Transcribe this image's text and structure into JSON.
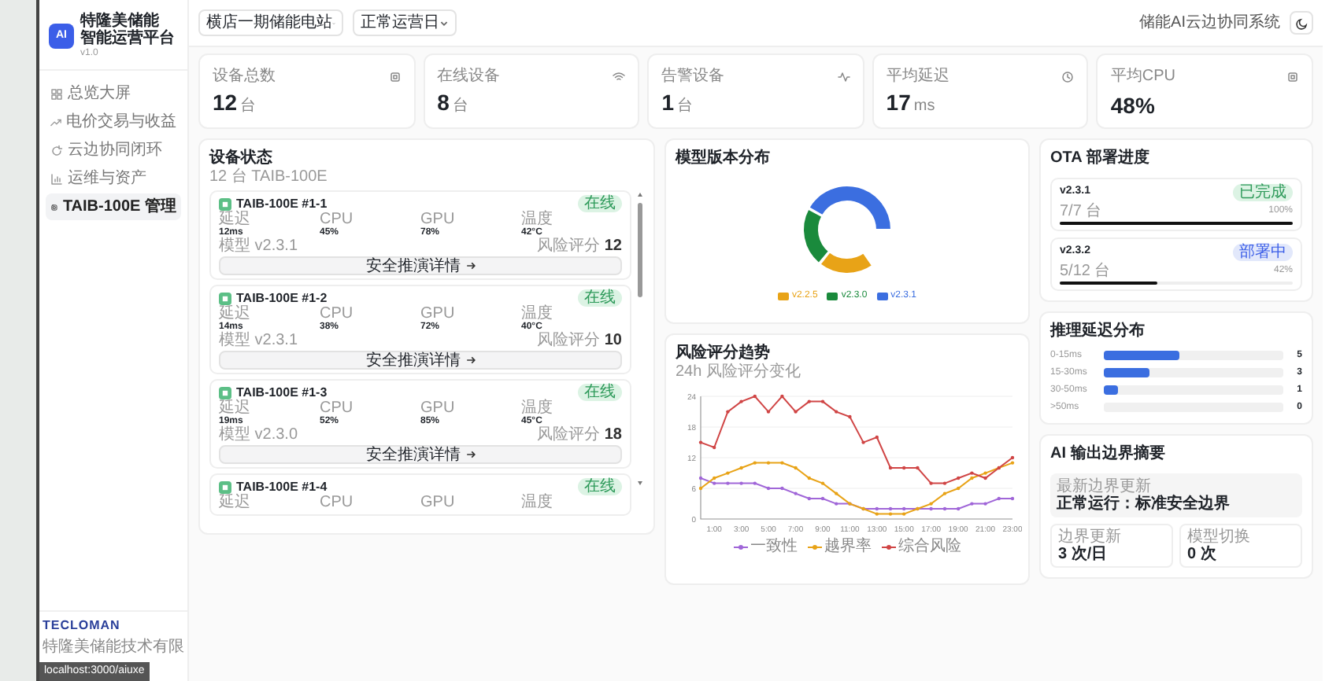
{
  "sidebar": {
    "logo": "AI",
    "title_line_1": "特隆美储能",
    "title_line_2": "智能运营平台",
    "version": "v1.0",
    "items": [
      {
        "label": "总览大屏",
        "selected": false
      },
      {
        "label": "电价交易与收益",
        "selected": false
      },
      {
        "label": "云边协同闭环",
        "selected": false
      },
      {
        "label": "运维与资产",
        "selected": false
      },
      {
        "label": "TAIB-100E 管理",
        "selected": true
      }
    ],
    "footer_logo": "TECLOMAN",
    "footer_text": "特隆美储能技术有限"
  },
  "topbar": {
    "site": "横店一期储能电站",
    "mode": "正常运营日",
    "system": "储能AI云边协同系统"
  },
  "stats": [
    {
      "label": "设备总数",
      "value": "12",
      "unit": "台"
    },
    {
      "label": "在线设备",
      "value": "8",
      "unit": "台"
    },
    {
      "label": "告警设备",
      "value": "1",
      "unit": "台"
    },
    {
      "label": "平均延迟",
      "value": "17",
      "unit": "ms"
    },
    {
      "label": "平均CPU",
      "value": "48%"
    }
  ],
  "devices": {
    "title": "设备状态",
    "subtitle": "12 台 TAIB-100E",
    "items": [
      {
        "name": "TAIB-100E #1-1",
        "status": "在线",
        "metrics": [
          {
            "label": "延迟",
            "value": "12ms"
          },
          {
            "label": "CPU",
            "value": "45%"
          },
          {
            "label": "GPU",
            "value": "78%"
          },
          {
            "label": "温度",
            "value": "42°C"
          }
        ],
        "model": "模型 v2.3.1",
        "risk_label": "风险评分",
        "risk": "12",
        "action": "安全推演详情"
      },
      {
        "name": "TAIB-100E #1-2",
        "status": "在线",
        "metrics": [
          {
            "label": "延迟",
            "value": "14ms"
          },
          {
            "label": "CPU",
            "value": "38%"
          },
          {
            "label": "GPU",
            "value": "72%"
          },
          {
            "label": "温度",
            "value": "40°C"
          }
        ],
        "model": "模型 v2.3.1",
        "risk_label": "风险评分",
        "risk": "10",
        "action": "安全推演详情"
      },
      {
        "name": "TAIB-100E #1-3",
        "status": "在线",
        "metrics": [
          {
            "label": "延迟",
            "value": "19ms"
          },
          {
            "label": "CPU",
            "value": "52%"
          },
          {
            "label": "GPU",
            "value": "85%"
          },
          {
            "label": "温度",
            "value": "45°C"
          }
        ],
        "model": "模型 v2.3.0",
        "risk_label": "风险评分",
        "risk": "18",
        "action": "安全推演详情"
      },
      {
        "name": "TAIB-100E #1-4",
        "status": "在线",
        "metrics": [
          {
            "label": "延迟"
          },
          {
            "label": "CPU"
          },
          {
            "label": "GPU"
          },
          {
            "label": "温度"
          }
        ]
      }
    ]
  },
  "model_versions": {
    "title": "模型版本分布",
    "legend": [
      {
        "label": "v2.2.5",
        "color": "#e8a317"
      },
      {
        "label": "v2.3.0",
        "color": "#1a8a3c"
      },
      {
        "label": "v2.3.1",
        "color": "#3b6ee0"
      }
    ]
  },
  "risk_trend": {
    "title": "风险评分趋势",
    "subtitle": "24h 风险评分变化",
    "chart_data": {
      "type": "line",
      "x": [
        0,
        1,
        2,
        3,
        4,
        5,
        6,
        7,
        8,
        9,
        10,
        11,
        12,
        13,
        14,
        15,
        16,
        17,
        18,
        19,
        20,
        21,
        22,
        23
      ],
      "xlim": [
        0,
        23
      ],
      "ylim": [
        0,
        24
      ],
      "grid": true,
      "legend": true,
      "yticks": [
        0,
        6,
        12,
        18,
        24
      ],
      "xticks": [
        {
          "value": 1,
          "label": "1:00"
        },
        {
          "value": 3,
          "label": "3:00"
        },
        {
          "value": 5,
          "label": "5:00"
        },
        {
          "value": 7,
          "label": "7:00"
        },
        {
          "value": 9,
          "label": "9:00"
        },
        {
          "value": 11,
          "label": "11:00"
        },
        {
          "value": 13,
          "label": "13:00"
        },
        {
          "value": 15,
          "label": "15:00"
        },
        {
          "value": 17,
          "label": "17:00"
        },
        {
          "value": 19,
          "label": "19:00"
        },
        {
          "value": 21,
          "label": "21:00"
        },
        {
          "value": 23,
          "label": "23:00"
        }
      ],
      "series": [
        {
          "name": "一致性",
          "color": "#a066d8",
          "values": [
            8,
            7,
            7,
            7,
            7,
            6,
            6,
            5,
            4,
            4,
            3,
            3,
            2,
            2,
            2,
            2,
            2,
            2,
            2,
            2,
            3,
            3,
            4,
            4
          ]
        },
        {
          "name": "越界率",
          "color": "#e8a317",
          "values": [
            6,
            8,
            9,
            10,
            11,
            11,
            11,
            10,
            8,
            7,
            5,
            3,
            2,
            1,
            1,
            1,
            2,
            3,
            5,
            6,
            8,
            9,
            10,
            11
          ]
        },
        {
          "name": "综合风险",
          "color": "#d04545",
          "values": [
            15,
            14,
            21,
            23,
            24,
            21,
            24,
            21,
            23,
            23,
            21,
            20,
            15,
            16,
            10,
            10,
            10,
            7,
            7,
            8,
            9,
            8,
            10,
            12
          ]
        }
      ]
    }
  },
  "ota": {
    "title": "OTA 部署进度",
    "items": [
      {
        "version": "v2.3.1",
        "status": "已完成",
        "kind": "done",
        "count": "7/7 台",
        "percent": "100%",
        "level": 1
      },
      {
        "version": "v2.3.2",
        "status": "部署中",
        "kind": "deploying",
        "count": "5/12 台",
        "percent": "42%",
        "level": 0.42
      }
    ]
  },
  "latency": {
    "title": "推理延迟分布",
    "rows": [
      {
        "label": "0-15ms",
        "count": "5",
        "level": 0.42
      },
      {
        "label": "15-30ms",
        "count": "3",
        "level": 0.25
      },
      {
        "label": "30-50ms",
        "count": "1",
        "level": 0.08
      },
      {
        "label": ">50ms",
        "count": "0",
        "level": 0
      }
    ]
  },
  "ai_boundary": {
    "title": "AI 输出边界摘要",
    "latest_label": "最新边界更新",
    "latest_value": "正常运行：标准安全边界",
    "stats": [
      {
        "label": "边界更新",
        "value": "3 次/日"
      },
      {
        "label": "模型切换",
        "value": "0 次"
      }
    ]
  },
  "status_url": "localhost:3000/aiuxe"
}
